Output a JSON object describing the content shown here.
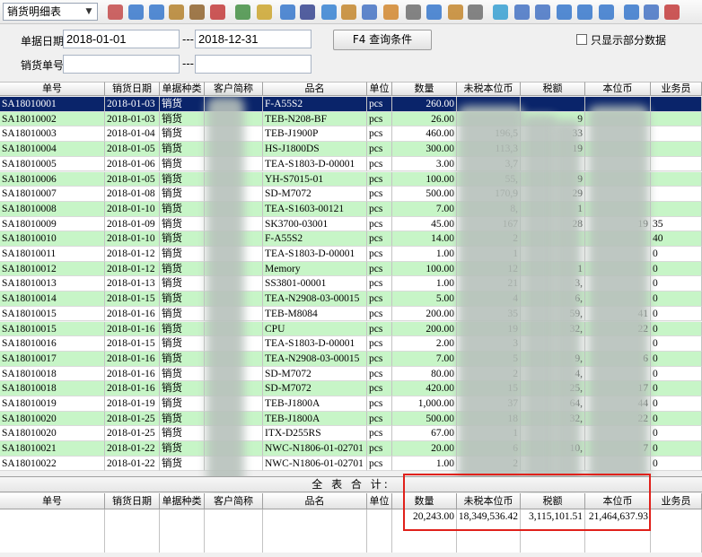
{
  "toolbar": {
    "report_select": "销货明细表",
    "icons": [
      "filter-icon",
      "save-icon",
      "refresh-icon",
      "lock-icon",
      "briefcase-icon",
      "export-icon",
      "grid-icon",
      "folder-icon",
      "layout-icon",
      "arrow-icon",
      "help-icon",
      "dollar-icon",
      "cart-icon",
      "money-icon",
      "chart-icon",
      "report-icon",
      "card-icon",
      "copy-icon",
      "check-icon",
      "print-icon",
      "zoom-icon",
      "tree-icon",
      "monitor-icon",
      "gear-icon",
      "window-icon",
      "close-icon",
      "exit-icon"
    ]
  },
  "filters": {
    "date_label": "单据日期",
    "date_from": "2018-01-01",
    "date_to": "2018-12-31",
    "range_sep": "---",
    "doc_label": "销货单号",
    "doc_from": "",
    "doc_to": "",
    "query_button": "F4 查询条件",
    "partial_checkbox": "只显示部分数据"
  },
  "columns": [
    "单号",
    "销货日期",
    "单据种类",
    "客户简称",
    "品名",
    "单位",
    "数量",
    "未税本位币",
    "税额",
    "本位币",
    "业务员"
  ],
  "rows": [
    [
      "SA18010001",
      "2018-01-03",
      "销货",
      "",
      "F-A55S2",
      "pcs",
      "260.00",
      "",
      "",
      "",
      ""
    ],
    [
      "SA18010002",
      "2018-01-03",
      "销货",
      "",
      "TEB-N208-BF",
      "pcs",
      "26.00",
      "",
      "9",
      "",
      ""
    ],
    [
      "SA18010003",
      "2018-01-04",
      "销货",
      "",
      "TEB-J1900P",
      "pcs",
      "460.00",
      "196,5",
      "33",
      "",
      ""
    ],
    [
      "SA18010004",
      "2018-01-05",
      "销货",
      "",
      "HS-J1800DS",
      "pcs",
      "300.00",
      "113,3",
      "19",
      "",
      ""
    ],
    [
      "SA18010005",
      "2018-01-06",
      "销货",
      "",
      "TEA-S1803-D-00001",
      "pcs",
      "3.00",
      "3,7",
      "",
      "",
      ""
    ],
    [
      "SA18010006",
      "2018-01-05",
      "销货",
      "",
      "YH-S7015-01",
      "pcs",
      "100.00",
      "55,",
      "9",
      "",
      ""
    ],
    [
      "SA18010007",
      "2018-01-08",
      "销货",
      "",
      "SD-M7072",
      "pcs",
      "500.00",
      "170,9",
      "29",
      "",
      ""
    ],
    [
      "SA18010008",
      "2018-01-10",
      "销货",
      "",
      "TEA-S1603-00121",
      "pcs",
      "7.00",
      "8,",
      "1",
      "",
      ""
    ],
    [
      "SA18010009",
      "2018-01-09",
      "销货",
      "",
      "SK3700-03001",
      "pcs",
      "45.00",
      "167",
      "28",
      "19",
      "35"
    ],
    [
      "SA18010010",
      "2018-01-10",
      "销货",
      "",
      "F-A55S2",
      "pcs",
      "14.00",
      "2",
      "",
      "",
      "40"
    ],
    [
      "SA18010011",
      "2018-01-12",
      "销货",
      "",
      "TEA-S1803-D-00001",
      "pcs",
      "1.00",
      "1",
      "",
      "",
      "0"
    ],
    [
      "SA18010012",
      "2018-01-12",
      "销货",
      "",
      "Memory",
      "pcs",
      "100.00",
      "12",
      "1",
      "",
      "0"
    ],
    [
      "SA18010013",
      "2018-01-13",
      "销货",
      "",
      "SS3801-00001",
      "pcs",
      "1.00",
      "21",
      "3,",
      "",
      "0"
    ],
    [
      "SA18010014",
      "2018-01-15",
      "销货",
      "",
      "TEA-N2908-03-00015",
      "pcs",
      "5.00",
      "4",
      "6,",
      "",
      "0"
    ],
    [
      "SA18010015",
      "2018-01-16",
      "销货",
      "",
      "TEB-M8084",
      "pcs",
      "200.00",
      "35",
      "59,",
      "41",
      "0"
    ],
    [
      "SA18010015",
      "2018-01-16",
      "销货",
      "",
      "CPU",
      "pcs",
      "200.00",
      "19",
      "32,",
      "22",
      "0"
    ],
    [
      "SA18010016",
      "2018-01-15",
      "销货",
      "",
      "TEA-S1803-D-00001",
      "pcs",
      "2.00",
      "3",
      "",
      "",
      "0"
    ],
    [
      "SA18010017",
      "2018-01-16",
      "销货",
      "",
      "TEA-N2908-03-00015",
      "pcs",
      "7.00",
      "5",
      "9,",
      "6",
      "0"
    ],
    [
      "SA18010018",
      "2018-01-16",
      "销货",
      "",
      "SD-M7072",
      "pcs",
      "80.00",
      "2",
      "4,",
      "",
      "0"
    ],
    [
      "SA18010018",
      "2018-01-16",
      "销货",
      "",
      "SD-M7072",
      "pcs",
      "420.00",
      "15",
      "25,",
      "17",
      "0"
    ],
    [
      "SA18010019",
      "2018-01-19",
      "销货",
      "",
      "TEB-J1800A",
      "pcs",
      "1,000.00",
      "37",
      "64,",
      "44",
      "0"
    ],
    [
      "SA18010020",
      "2018-01-25",
      "销货",
      "",
      "TEB-J1800A",
      "pcs",
      "500.00",
      "18",
      "32,",
      "22",
      "0"
    ],
    [
      "SA18010020",
      "2018-01-25",
      "销货",
      "",
      "ITX-D255RS",
      "pcs",
      "67.00",
      "1",
      "",
      "",
      "0"
    ],
    [
      "SA18010021",
      "2018-01-22",
      "销货",
      "",
      "NWC-N1806-01-02701",
      "pcs",
      "20.00",
      "6",
      "10,",
      "7",
      "0"
    ],
    [
      "SA18010022",
      "2018-01-22",
      "销货",
      "",
      "NWC-N1806-01-02701",
      "pcs",
      "1.00",
      "2",
      "",
      "",
      "0"
    ]
  ],
  "totals": {
    "title": "全 表 合 计:",
    "columns": [
      "单号",
      "销货日期",
      "单据种类",
      "客户简称",
      "品名",
      "单位",
      "数量",
      "未税本位币",
      "税额",
      "本位币",
      "业务员"
    ],
    "quantity": "20,243.00",
    "untaxed": "18,349,536.42",
    "tax": "3,115,101.51",
    "base": "21,464,637.93"
  },
  "colors": {
    "selected_row": "#0a246a",
    "green_row": "#c7f5c7",
    "highlight_box": "#e0201a"
  }
}
